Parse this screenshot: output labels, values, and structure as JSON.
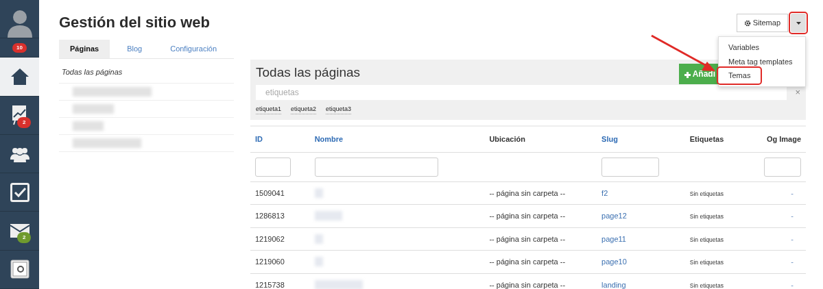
{
  "sidebar": {
    "notification_count": "10",
    "items": [
      {
        "kind": "home",
        "selected": true
      },
      {
        "kind": "chart",
        "selected": false,
        "badge": "2",
        "color": "#d9302c"
      },
      {
        "kind": "users",
        "selected": false
      },
      {
        "kind": "tasks",
        "selected": false
      },
      {
        "kind": "mail",
        "selected": false,
        "badge": "2",
        "color": "#6f9a2e"
      },
      {
        "kind": "safe",
        "selected": false
      }
    ]
  },
  "page_title": "Gestión del sitio web",
  "header_actions": {
    "sitemap_button": "Sitemap",
    "caret_highlighted": true,
    "dropdown": [
      {
        "label": "Variables",
        "highlighted": false
      },
      {
        "label": "Meta tag templates",
        "highlighted": false
      },
      {
        "label": "Temas",
        "highlighted": true
      }
    ]
  },
  "tabs": [
    {
      "label": "Páginas",
      "selected": true
    },
    {
      "label": "Blog",
      "selected": false
    },
    {
      "label": "Configuración",
      "selected": false
    }
  ],
  "folder_panel": {
    "title": "Todas las páginas"
  },
  "pages_panel": {
    "title": "Todas las páginas",
    "add_button": "Añadi",
    "tag_search": {
      "placeholder": "etiquetas"
    },
    "clear": "×",
    "tags": [
      "etiqueta1",
      "etiqueta2",
      "etiqueta3"
    ]
  },
  "table": {
    "columns": [
      {
        "label": "ID",
        "sortable": true,
        "filter": true
      },
      {
        "label": "Nombre",
        "sortable": true,
        "filter": true
      },
      {
        "label": "Ubicación",
        "sortable": false,
        "filter": false
      },
      {
        "label": "Slug",
        "sortable": true,
        "filter": true
      },
      {
        "label": "Etiquetas",
        "sortable": false,
        "filter": false
      },
      {
        "label": "Og Image",
        "sortable": false,
        "filter": true
      }
    ],
    "rows": [
      {
        "id": "1509041",
        "location": "-- página sin carpeta --",
        "slug": "f2",
        "tags": "Sin etiquetas",
        "og_image": "-"
      },
      {
        "id": "1286813",
        "location": "-- página sin carpeta --",
        "slug": "page12",
        "tags": "Sin etiquetas",
        "og_image": "-"
      },
      {
        "id": "1219062",
        "location": "-- página sin carpeta --",
        "slug": "page11",
        "tags": "Sin etiquetas",
        "og_image": "-"
      },
      {
        "id": "1219060",
        "location": "-- página sin carpeta --",
        "slug": "page10",
        "tags": "Sin etiquetas",
        "og_image": "-"
      },
      {
        "id": "1215738",
        "location": "-- página sin carpeta --",
        "slug": "landing",
        "tags": "Sin etiquetas",
        "og_image": "-"
      }
    ]
  }
}
